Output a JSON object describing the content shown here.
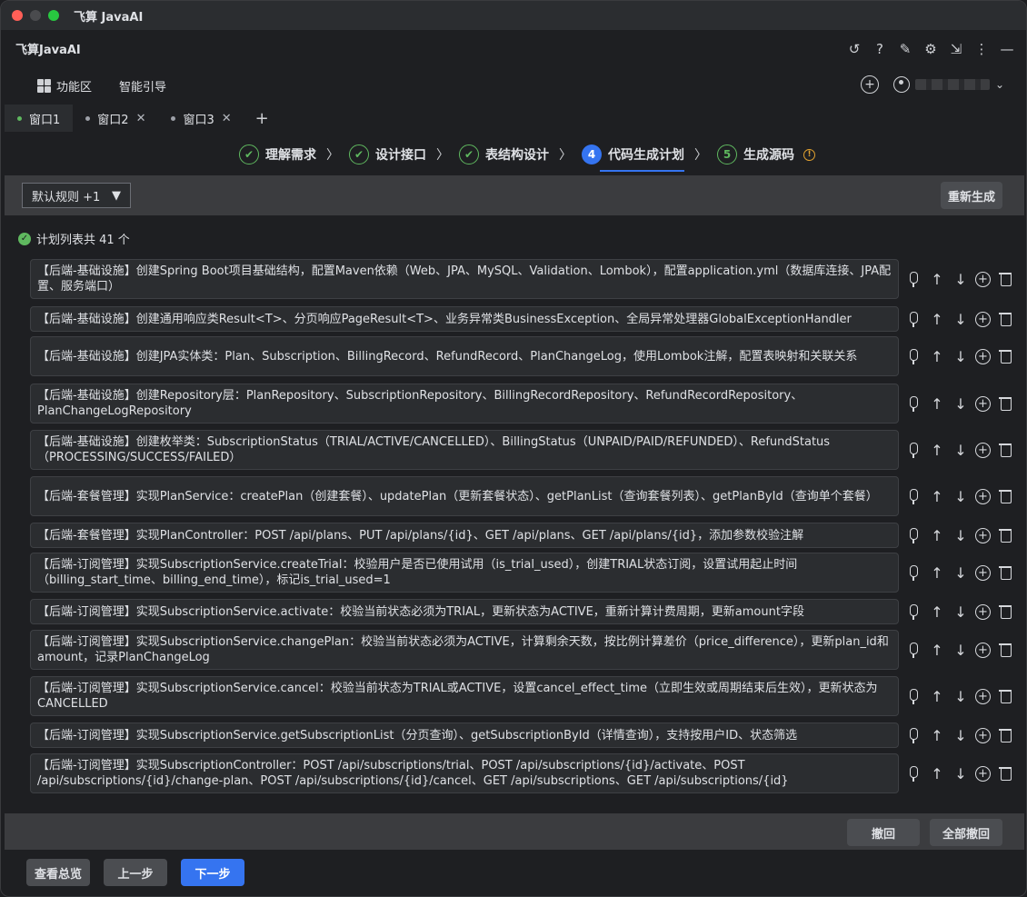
{
  "window": {
    "title": "飞算 JavaAI"
  },
  "plugin": {
    "name": "飞算JavaAI",
    "tools": [
      "history-icon",
      "help-icon",
      "edit-icon",
      "settings-icon",
      "collapse-icon",
      "more-icon",
      "minimize-icon"
    ]
  },
  "nav": {
    "function_area": "功能区",
    "smart_guide": "智能引导"
  },
  "window_tabs": [
    {
      "label": "窗口1",
      "active": true
    },
    {
      "label": "窗口2",
      "active": false
    },
    {
      "label": "窗口3",
      "active": false
    }
  ],
  "steps": [
    {
      "label": "理解需求",
      "state": "done"
    },
    {
      "label": "设计接口",
      "state": "done"
    },
    {
      "label": "表结构设计",
      "state": "done"
    },
    {
      "label": "代码生成计划",
      "state": "current",
      "number": "4"
    },
    {
      "label": "生成源码",
      "state": "todo",
      "number": "5"
    }
  ],
  "toolbar": {
    "rule_select": "默认规则 +1",
    "regenerate": "重新生成"
  },
  "plan": {
    "count_text": "计划列表共 41 个",
    "items": [
      "【后端-基础设施】创建Spring Boot项目基础结构，配置Maven依赖（Web、JPA、MySQL、Validation、Lombok），配置application.yml（数据库连接、JPA配置、服务端口）",
      "【后端-基础设施】创建通用响应类Result<T>、分页响应PageResult<T>、业务异常类BusinessException、全局异常处理器GlobalExceptionHandler",
      "【后端-基础设施】创建JPA实体类：Plan、Subscription、BillingRecord、RefundRecord、PlanChangeLog，使用Lombok注解，配置表映射和关联关系",
      "【后端-基础设施】创建Repository层：PlanRepository、SubscriptionRepository、BillingRecordRepository、RefundRecordRepository、PlanChangeLogRepository",
      "【后端-基础设施】创建枚举类：SubscriptionStatus（TRIAL/ACTIVE/CANCELLED）、BillingStatus（UNPAID/PAID/REFUNDED）、RefundStatus（PROCESSING/SUCCESS/FAILED）",
      "【后端-套餐管理】实现PlanService：createPlan（创建套餐）、updatePlan（更新套餐状态）、getPlanList（查询套餐列表）、getPlanById（查询单个套餐）",
      "【后端-套餐管理】实现PlanController：POST /api/plans、PUT /api/plans/{id}、GET /api/plans、GET /api/plans/{id}，添加参数校验注解",
      "【后端-订阅管理】实现SubscriptionService.createTrial：校验用户是否已使用试用（is_trial_used），创建TRIAL状态订阅，设置试用起止时间（billing_start_time、billing_end_time），标记is_trial_used=1",
      "【后端-订阅管理】实现SubscriptionService.activate：校验当前状态必须为TRIAL，更新状态为ACTIVE，重新计算计费周期，更新amount字段",
      "【后端-订阅管理】实现SubscriptionService.changePlan：校验当前状态必须为ACTIVE，计算剩余天数，按比例计算差价（price_difference），更新plan_id和amount，记录PlanChangeLog",
      "【后端-订阅管理】实现SubscriptionService.cancel：校验当前状态为TRIAL或ACTIVE，设置cancel_effect_time（立即生效或周期结束后生效），更新状态为CANCELLED",
      "【后端-订阅管理】实现SubscriptionService.getSubscriptionList（分页查询）、getSubscriptionById（详情查询），支持按用户ID、状态筛选",
      "【后端-订阅管理】实现SubscriptionController：POST /api/subscriptions/trial、POST /api/subscriptions/{id}/activate、POST /api/subscriptions/{id}/change-plan、POST /api/subscriptions/{id}/cancel、GET /api/subscriptions、GET /api/subscriptions/{id}"
    ]
  },
  "undo_bar": {
    "undo": "撤回",
    "undo_all": "全部撤回"
  },
  "footer": {
    "overview": "查看总览",
    "prev": "上一步",
    "next": "下一步"
  },
  "colors": {
    "accent": "#3574f0",
    "success": "#5fb85f",
    "warning": "#e0a030"
  }
}
